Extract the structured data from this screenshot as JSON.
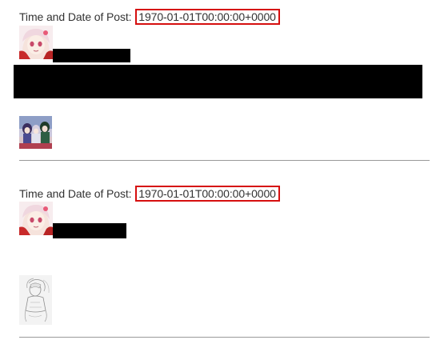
{
  "posts": [
    {
      "time_label": "Time and Date of Post:",
      "timestamp": "1970-01-01T00:00:00+0000",
      "avatar_icon": "anime-girl-avatar-icon",
      "attachment_icon": "group-photo-thumbnail"
    },
    {
      "time_label": "Time and Date of Post:",
      "timestamp": "1970-01-01T00:00:00+0000",
      "avatar_icon": "anime-girl-avatar-icon",
      "attachment_icon": "sketch-drawing-thumbnail"
    }
  ],
  "colors": {
    "highlight_border": "#d60f0f",
    "redaction": "#000000",
    "divider": "#9a9a9a",
    "text": "#333333"
  }
}
